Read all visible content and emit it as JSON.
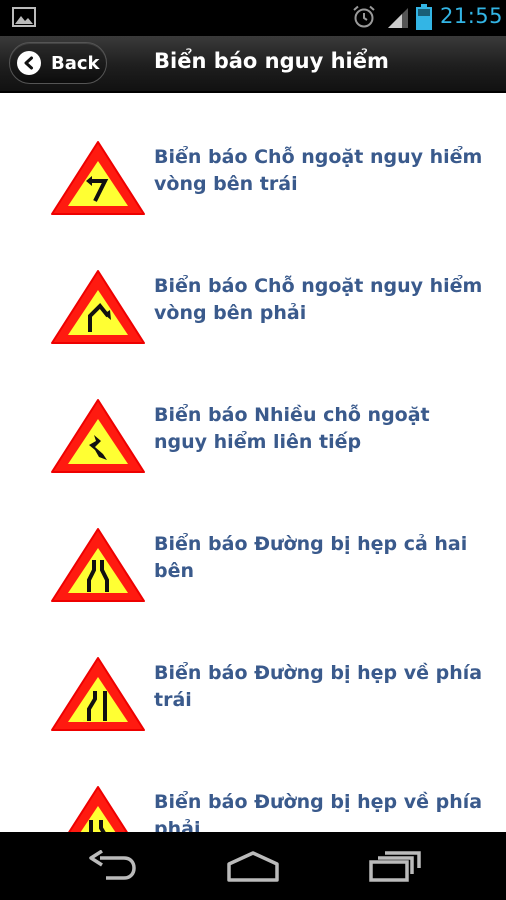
{
  "status_bar": {
    "time": "21:55",
    "icons": [
      "gallery-icon",
      "alarm-icon",
      "signal-icon",
      "battery-icon"
    ],
    "accent_color": "#33b5e5"
  },
  "action_bar": {
    "back_label": "Back",
    "title": "Biển báo nguy hiểm"
  },
  "list": {
    "text_color": "#3a5a8c",
    "items": [
      {
        "label": "Biển báo Chỗ ngoặt nguy hiểm vòng bên trái",
        "icon": "warning-sign-curve-left-icon"
      },
      {
        "label": "Biển báo Chỗ ngoặt nguy hiểm vòng bên phải",
        "icon": "warning-sign-curve-right-icon"
      },
      {
        "label": "Biển báo Nhiều chỗ ngoặt nguy hiểm liên tiếp",
        "icon": "warning-sign-multiple-curves-icon"
      },
      {
        "label": "Biển báo Đường bị hẹp cả hai bên",
        "icon": "warning-sign-road-narrows-both-icon"
      },
      {
        "label": "Biển báo Đường bị hẹp về phía trái",
        "icon": "warning-sign-road-narrows-left-icon"
      },
      {
        "label": "Biển báo Đường bị hẹp về phía phải",
        "icon": "warning-sign-road-narrows-right-icon"
      }
    ]
  },
  "nav_bar": {
    "icons": [
      "nav-back-icon",
      "nav-home-icon",
      "nav-recents-icon"
    ]
  }
}
